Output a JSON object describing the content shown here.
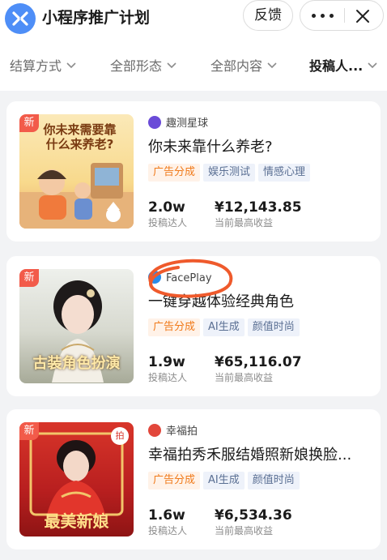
{
  "header": {
    "app_title": "小程序推广计划",
    "feedback_label": "反馈",
    "more_icon": "more-dots-icon",
    "close_icon": "close-icon",
    "brand_color": "#4e8ef7"
  },
  "filters": [
    {
      "label": "结算方式",
      "active": false
    },
    {
      "label": "全部形态",
      "active": false
    },
    {
      "label": "全部内容",
      "active": false
    },
    {
      "label": "投稿人...",
      "active": true
    }
  ],
  "cards": [
    {
      "new_label": "新",
      "source": "趣测星球",
      "source_icon_color": "#6a4bd8",
      "title": "你未来靠什么养老?",
      "thumb_text": "你未来需要靠什么来养老?",
      "tags": [
        {
          "label": "广告分成",
          "style": "orange"
        },
        {
          "label": "娱乐测试",
          "style": "blue"
        },
        {
          "label": "情感心理",
          "style": "blue"
        }
      ],
      "stats": {
        "contributors": "2.0w",
        "contributors_label": "投稿达人",
        "earnings": "¥12,143.85",
        "earnings_label": "当前最高收益"
      }
    },
    {
      "new_label": "新",
      "source": "FacePlay",
      "source_icon_color": "#2a8be8",
      "title": "一键穿越体验经典角色",
      "thumb_text": "古装角色扮演",
      "tags": [
        {
          "label": "广告分成",
          "style": "orange"
        },
        {
          "label": "AI生成",
          "style": "blue"
        },
        {
          "label": "颜值时尚",
          "style": "blue"
        }
      ],
      "stats": {
        "contributors": "1.9w",
        "contributors_label": "投稿达人",
        "earnings": "¥65,116.07",
        "earnings_label": "当前最高收益"
      }
    },
    {
      "new_label": "新",
      "source": "幸福拍",
      "source_icon_color": "#e2473b",
      "title": "幸福拍秀禾服结婚照新娘换脸...",
      "thumb_text": "最美新娘",
      "thumb_badge": "拍",
      "tags": [
        {
          "label": "广告分成",
          "style": "orange"
        },
        {
          "label": "AI生成",
          "style": "blue"
        },
        {
          "label": "颜值时尚",
          "style": "blue"
        }
      ],
      "stats": {
        "contributors": "1.6w",
        "contributors_label": "投稿达人",
        "earnings": "¥6,534.36",
        "earnings_label": "当前最高收益"
      }
    }
  ]
}
